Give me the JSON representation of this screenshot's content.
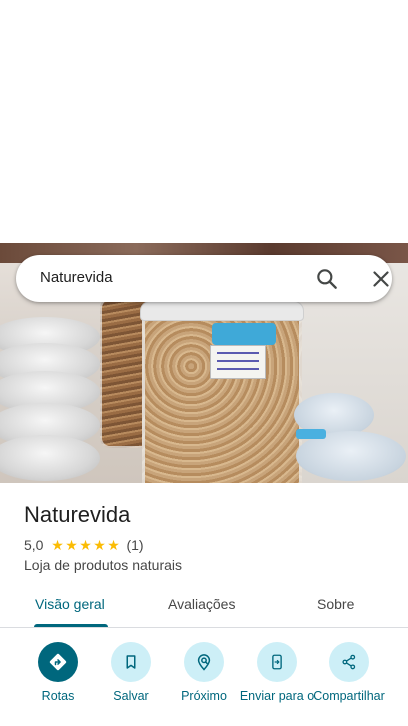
{
  "search": {
    "query": "Naturevida",
    "search_icon": "search-icon",
    "close_icon": "close-icon"
  },
  "place": {
    "name": "Naturevida",
    "rating": "5,0",
    "stars": 5,
    "review_count": "(1)",
    "category": "Loja de produtos naturais"
  },
  "tabs": [
    {
      "label": "Visão geral",
      "active": true
    },
    {
      "label": "Avaliações",
      "active": false
    },
    {
      "label": "Sobre",
      "active": false
    }
  ],
  "actions": [
    {
      "label": "Rotas",
      "icon": "directions-icon"
    },
    {
      "label": "Salvar",
      "icon": "bookmark-icon"
    },
    {
      "label": "Próximo",
      "icon": "nearby-icon"
    },
    {
      "label": "Enviar para o",
      "icon": "send-to-phone-icon"
    },
    {
      "label": "Compartilhar",
      "icon": "share-icon"
    }
  ],
  "colors": {
    "accent": "#00677d",
    "accent_light": "#cdeff7",
    "star": "#fbbc04"
  }
}
